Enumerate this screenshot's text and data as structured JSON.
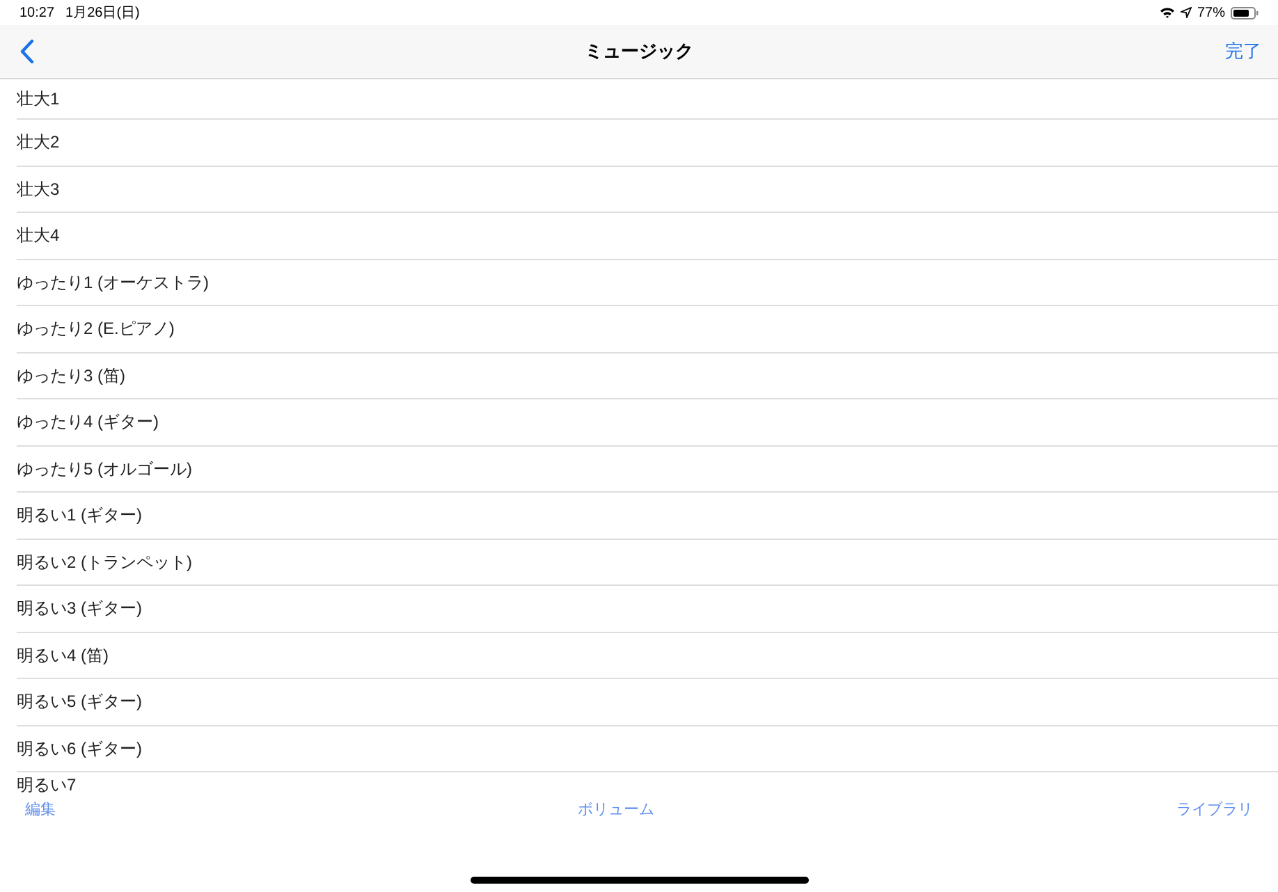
{
  "status_bar": {
    "time": "10:27",
    "date": "1月26日(日)",
    "battery_percent": "77%"
  },
  "nav_bar": {
    "title": "ミュージック",
    "done": "完了"
  },
  "list": {
    "items": [
      {
        "label": "壮大1"
      },
      {
        "label": "壮大2"
      },
      {
        "label": "壮大3"
      },
      {
        "label": "壮大4"
      },
      {
        "label": "ゆったり1 (オーケストラ)"
      },
      {
        "label": "ゆったり2 (E.ピアノ)"
      },
      {
        "label": "ゆったり3 (笛)"
      },
      {
        "label": "ゆったり4 (ギター)"
      },
      {
        "label": "ゆったり5 (オルゴール)"
      },
      {
        "label": "明るい1 (ギター)"
      },
      {
        "label": "明るい2 (トランペット)"
      },
      {
        "label": "明るい3 (ギター)"
      },
      {
        "label": "明るい4 (笛)"
      },
      {
        "label": "明るい5 (ギター)"
      },
      {
        "label": "明るい6 (ギター)"
      },
      {
        "label": "明るい7"
      }
    ]
  },
  "toolbar": {
    "left": "編集",
    "center": "ボリューム",
    "right": "ライブラリ"
  }
}
